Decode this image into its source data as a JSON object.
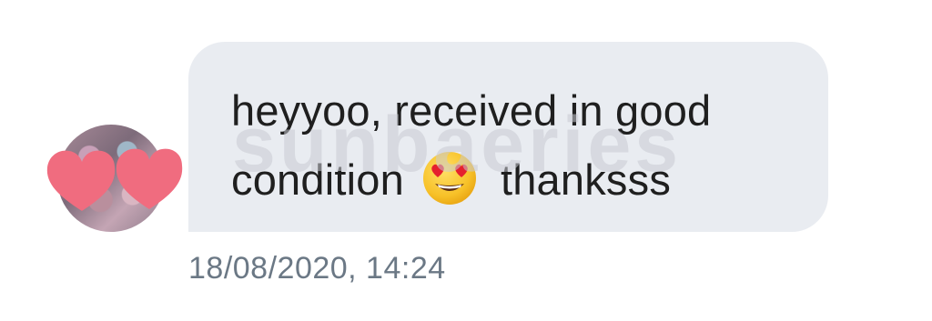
{
  "message": {
    "text_line1": "heyyoo, received in good",
    "text_line2_before": "condition",
    "emoji": "heart-eyes-emoji",
    "text_line2_after": "thanksss",
    "timestamp": "18/08/2020, 14:24"
  },
  "watermark": {
    "text": "sunbaeries"
  },
  "avatar": {
    "overlay_icon": "hearts-icon"
  },
  "colors": {
    "bubble": "#e9ecf1",
    "text": "#1f1f1f",
    "timestamp": "#6b7885",
    "heart": "#f06c7f"
  }
}
